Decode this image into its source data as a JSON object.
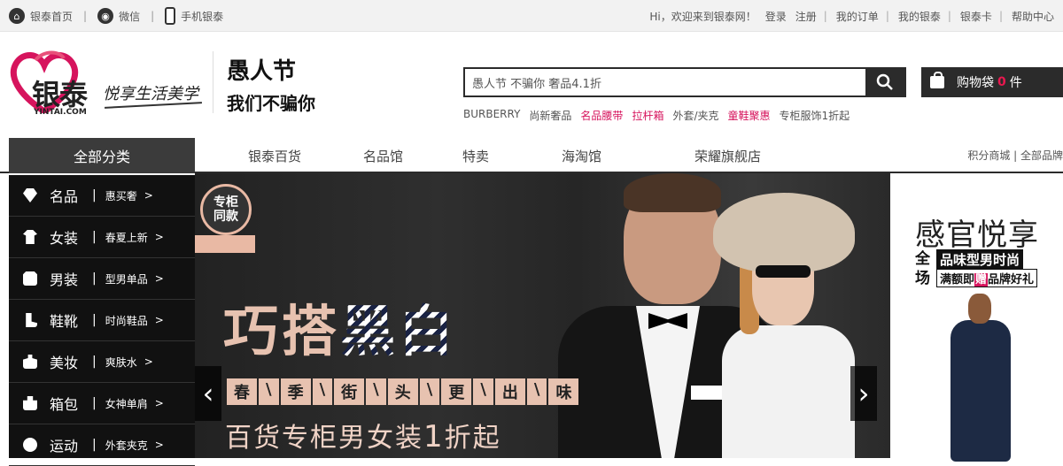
{
  "topbar": {
    "home": "银泰首页",
    "wechat": "微信",
    "mobile": "手机银泰",
    "welcome": "Hi，欢迎来到银泰网！",
    "login": "登录",
    "register": "注册",
    "orders": "我的订单",
    "my": "我的银泰",
    "card": "银泰卡",
    "help": "帮助中心"
  },
  "logo": {
    "brand": "银泰",
    "url": "YINTAI.COM",
    "slogan": "悦享生活美学"
  },
  "promo": {
    "title": "愚人节",
    "subtitle": "我们不骗你"
  },
  "search": {
    "value": "愚人节 不骗你 奢品4.1折"
  },
  "hotwords": [
    {
      "text": "BURBERRY",
      "red": false
    },
    {
      "text": "尚新奢品",
      "red": false
    },
    {
      "text": "名品腰带",
      "red": true
    },
    {
      "text": "拉杆箱",
      "red": true
    },
    {
      "text": "外套/夹克",
      "red": false
    },
    {
      "text": "童鞋聚惠",
      "red": true
    },
    {
      "text": "专柜服饰1折起",
      "red": false
    }
  ],
  "cart": {
    "label": "购物袋",
    "count": "0",
    "unit": "件"
  },
  "nav": {
    "all": "全部分类",
    "items": [
      "银泰百货",
      "名品馆",
      "特卖",
      "海淘馆",
      "荣耀旗舰店"
    ],
    "right": "积分商城 | 全部品牌"
  },
  "categories": [
    {
      "name": "名品",
      "sub": "惠买奢",
      "icon": "diamond-icon"
    },
    {
      "name": "女装",
      "sub": "春夏上新",
      "icon": "dress-icon"
    },
    {
      "name": "男装",
      "sub": "型男单品",
      "icon": "suit-icon"
    },
    {
      "name": "鞋靴",
      "sub": "时尚鞋品",
      "icon": "boot-icon"
    },
    {
      "name": "美妆",
      "sub": "爽肤水",
      "icon": "perfume-icon"
    },
    {
      "name": "箱包",
      "sub": "女神单肩",
      "icon": "handbag-icon"
    },
    {
      "name": "运动",
      "sub": "外套夹克",
      "icon": "ball-icon"
    }
  ],
  "banner": {
    "tag_line1": "专柜",
    "tag_line2": "同款",
    "headline_a": "巧搭",
    "headline_b": "黑白",
    "chips": [
      "春",
      "\\",
      "季",
      "\\",
      "街",
      "\\",
      "头",
      "\\",
      "更",
      "\\",
      "出",
      "\\",
      "味"
    ],
    "sub_a": "百货专柜男女装",
    "sub_num": "1",
    "sub_b": "折起"
  },
  "right_ad": {
    "title": "感官悦享",
    "quan": "全场",
    "box1": "品味型男时尚",
    "box2_a": "满额即",
    "box2_hl": "赠",
    "box2_b": "品牌好礼"
  },
  "colors": {
    "accent": "#d6145d",
    "dark": "#2b2b2b",
    "banner_pink": "#e7c2b0"
  }
}
